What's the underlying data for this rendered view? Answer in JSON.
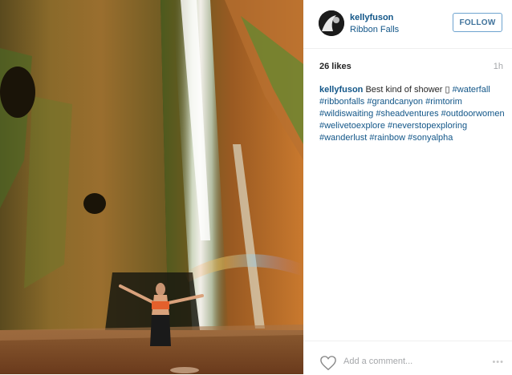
{
  "post": {
    "username": "kellyfuson",
    "location": "Ribbon Falls",
    "follow_label": "FOLLOW",
    "likes": "26 likes",
    "time": "1h",
    "caption_text": "Best kind of shower ▯ ",
    "hashtags": [
      "#waterfall",
      "#ribbonfalls",
      "#grandcanyon",
      "#rimtorim",
      "#wildiswaiting",
      "#sheadventures",
      "#outdoorwomen",
      "#welivetoexplore",
      "#neverstopexploring",
      "#wanderlust",
      "#rainbow",
      "#sonyalpha"
    ],
    "comment_placeholder": "Add a comment...",
    "more_label": "•••"
  },
  "icons": {
    "heart": "heart-icon",
    "avatar": "avatar"
  },
  "colors": {
    "link": "#125688",
    "follow_border": "#6ea3cf",
    "muted": "#a5a7aa"
  }
}
